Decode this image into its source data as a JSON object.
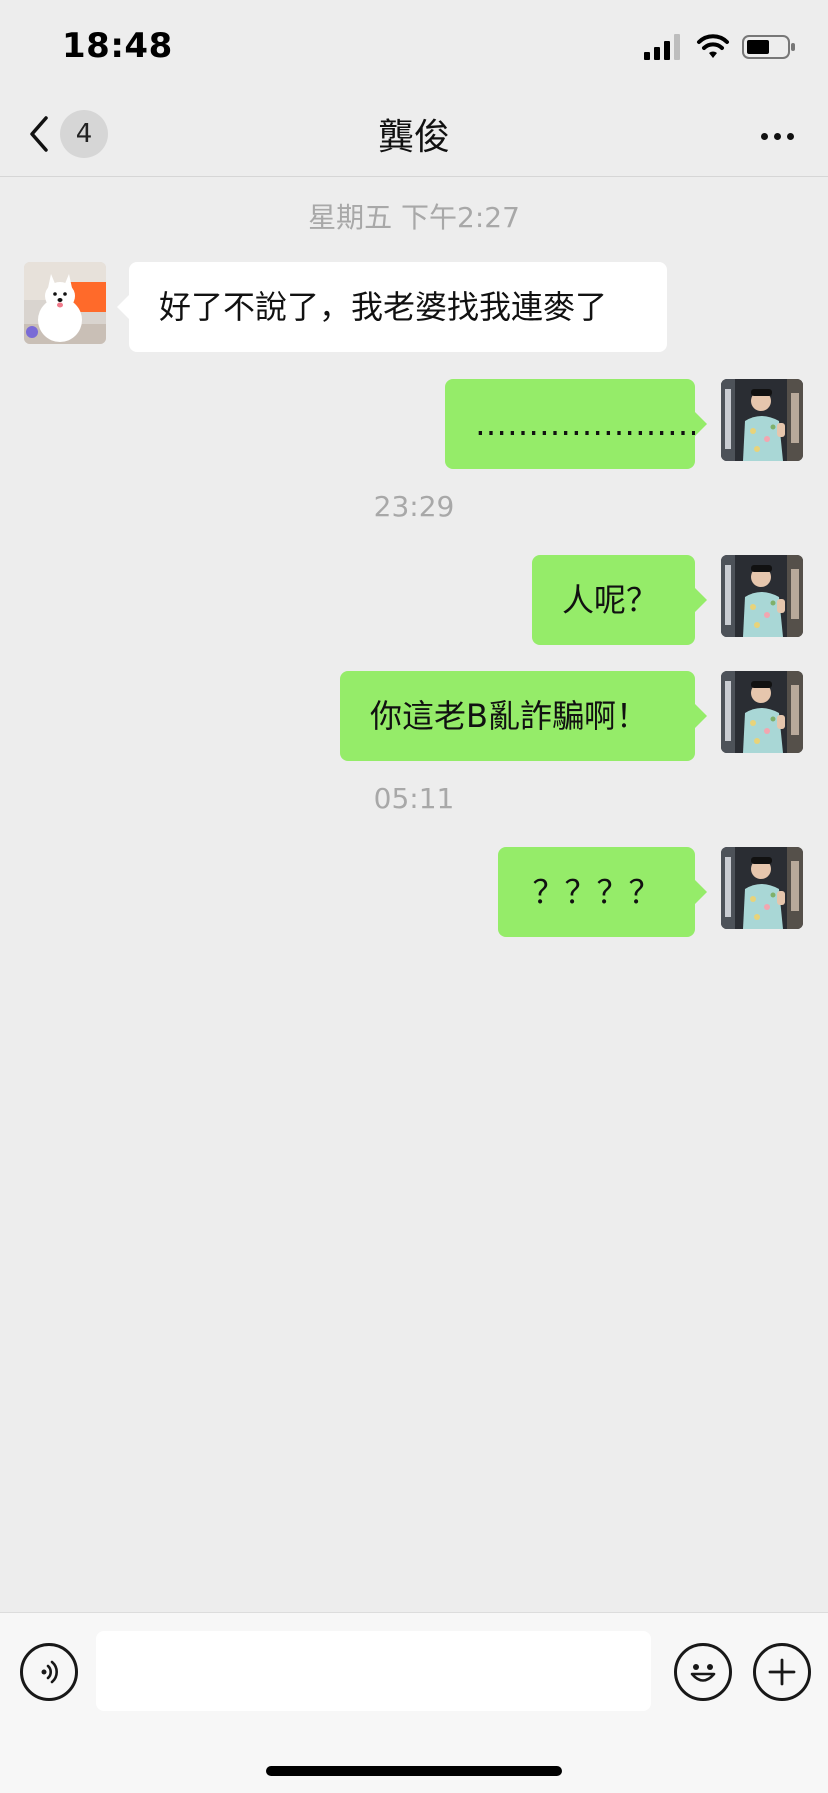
{
  "status_bar": {
    "time": "18:48",
    "icons": [
      "cellular-signal-icon",
      "wifi-icon",
      "battery-icon"
    ]
  },
  "nav": {
    "back_icon": "chevron-left-icon",
    "unread_badge": "4",
    "title": "龔俊",
    "more_icon": "more-dots-icon"
  },
  "messages": {
    "time_1": "星期五 下午2:27",
    "msg_1": "好了不說了，我老婆找我連麥了",
    "msg_2": "…………………",
    "time_2": "23:29",
    "msg_3": "人呢？",
    "msg_4": "你這老B亂詐騙啊！",
    "time_3": "05:11",
    "msg_5": "？？？？"
  },
  "input_bar": {
    "voice_icon": "voice-icon",
    "text_value": "",
    "emoji_icon": "emoji-icon",
    "plus_icon": "plus-icon"
  },
  "colors": {
    "background": "#ededed",
    "outgoing_bubble": "#95ec69",
    "incoming_bubble": "#ffffff",
    "timestamp_text": "#a8a8a8"
  }
}
